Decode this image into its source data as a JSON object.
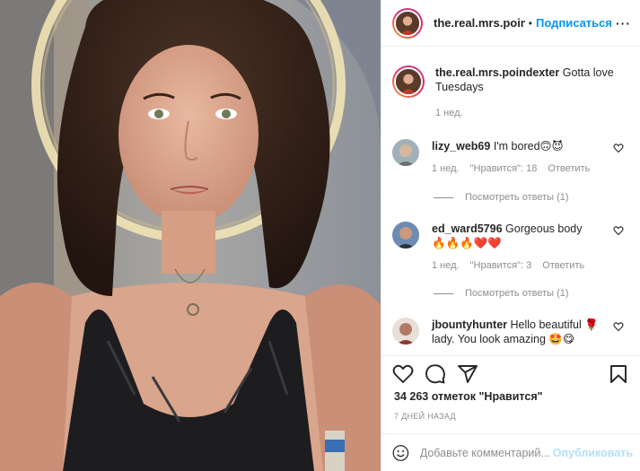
{
  "post": {
    "author": "the.real.mrs.poindexter",
    "author_truncated": "the.real.mrs.poinde",
    "dot": "•",
    "follow_label": "Подписаться",
    "more_label": "···",
    "caption": {
      "username": "the.real.mrs.poindexter",
      "text": "Gotta love Tuesdays",
      "time": "1 нед."
    },
    "comments": [
      {
        "username": "lizy_web69",
        "text": "I'm bored🙃😈",
        "time": "1 нед.",
        "likes": "\"Нравится\": 18",
        "reply": "Ответить",
        "view_replies": "Посмотреть ответы (1)"
      },
      {
        "username": "ed_ward5796",
        "text": "Gorgeous body 🔥🔥🔥❤️❤️",
        "time": "1 нед.",
        "likes": "\"Нравится\": 3",
        "reply": "Ответить",
        "view_replies": "Посмотреть ответы (1)"
      },
      {
        "username": "jbountyhunter",
        "text": "Hello beautiful 🌹 lady. You look amazing 🤩😋"
      }
    ],
    "likes_count": "34 263 отметок \"Нравится\"",
    "date": "7 ДНЕЙ НАЗАД",
    "add_comment_placeholder": "Добавьте комментарий...",
    "publish_label": "Опубликовать"
  },
  "colors": {
    "link": "#0095f6",
    "muted": "#8e8e8e",
    "publish_disabled": "#b2dffc",
    "story_ring": [
      "#f9a13a",
      "#e1306c",
      "#c13584"
    ]
  },
  "icons": {
    "actions": [
      "heart-icon",
      "comment-icon",
      "share-icon",
      "bookmark-icon"
    ],
    "comment_like": "heart-outline-icon",
    "emoji": "smiley-icon"
  }
}
